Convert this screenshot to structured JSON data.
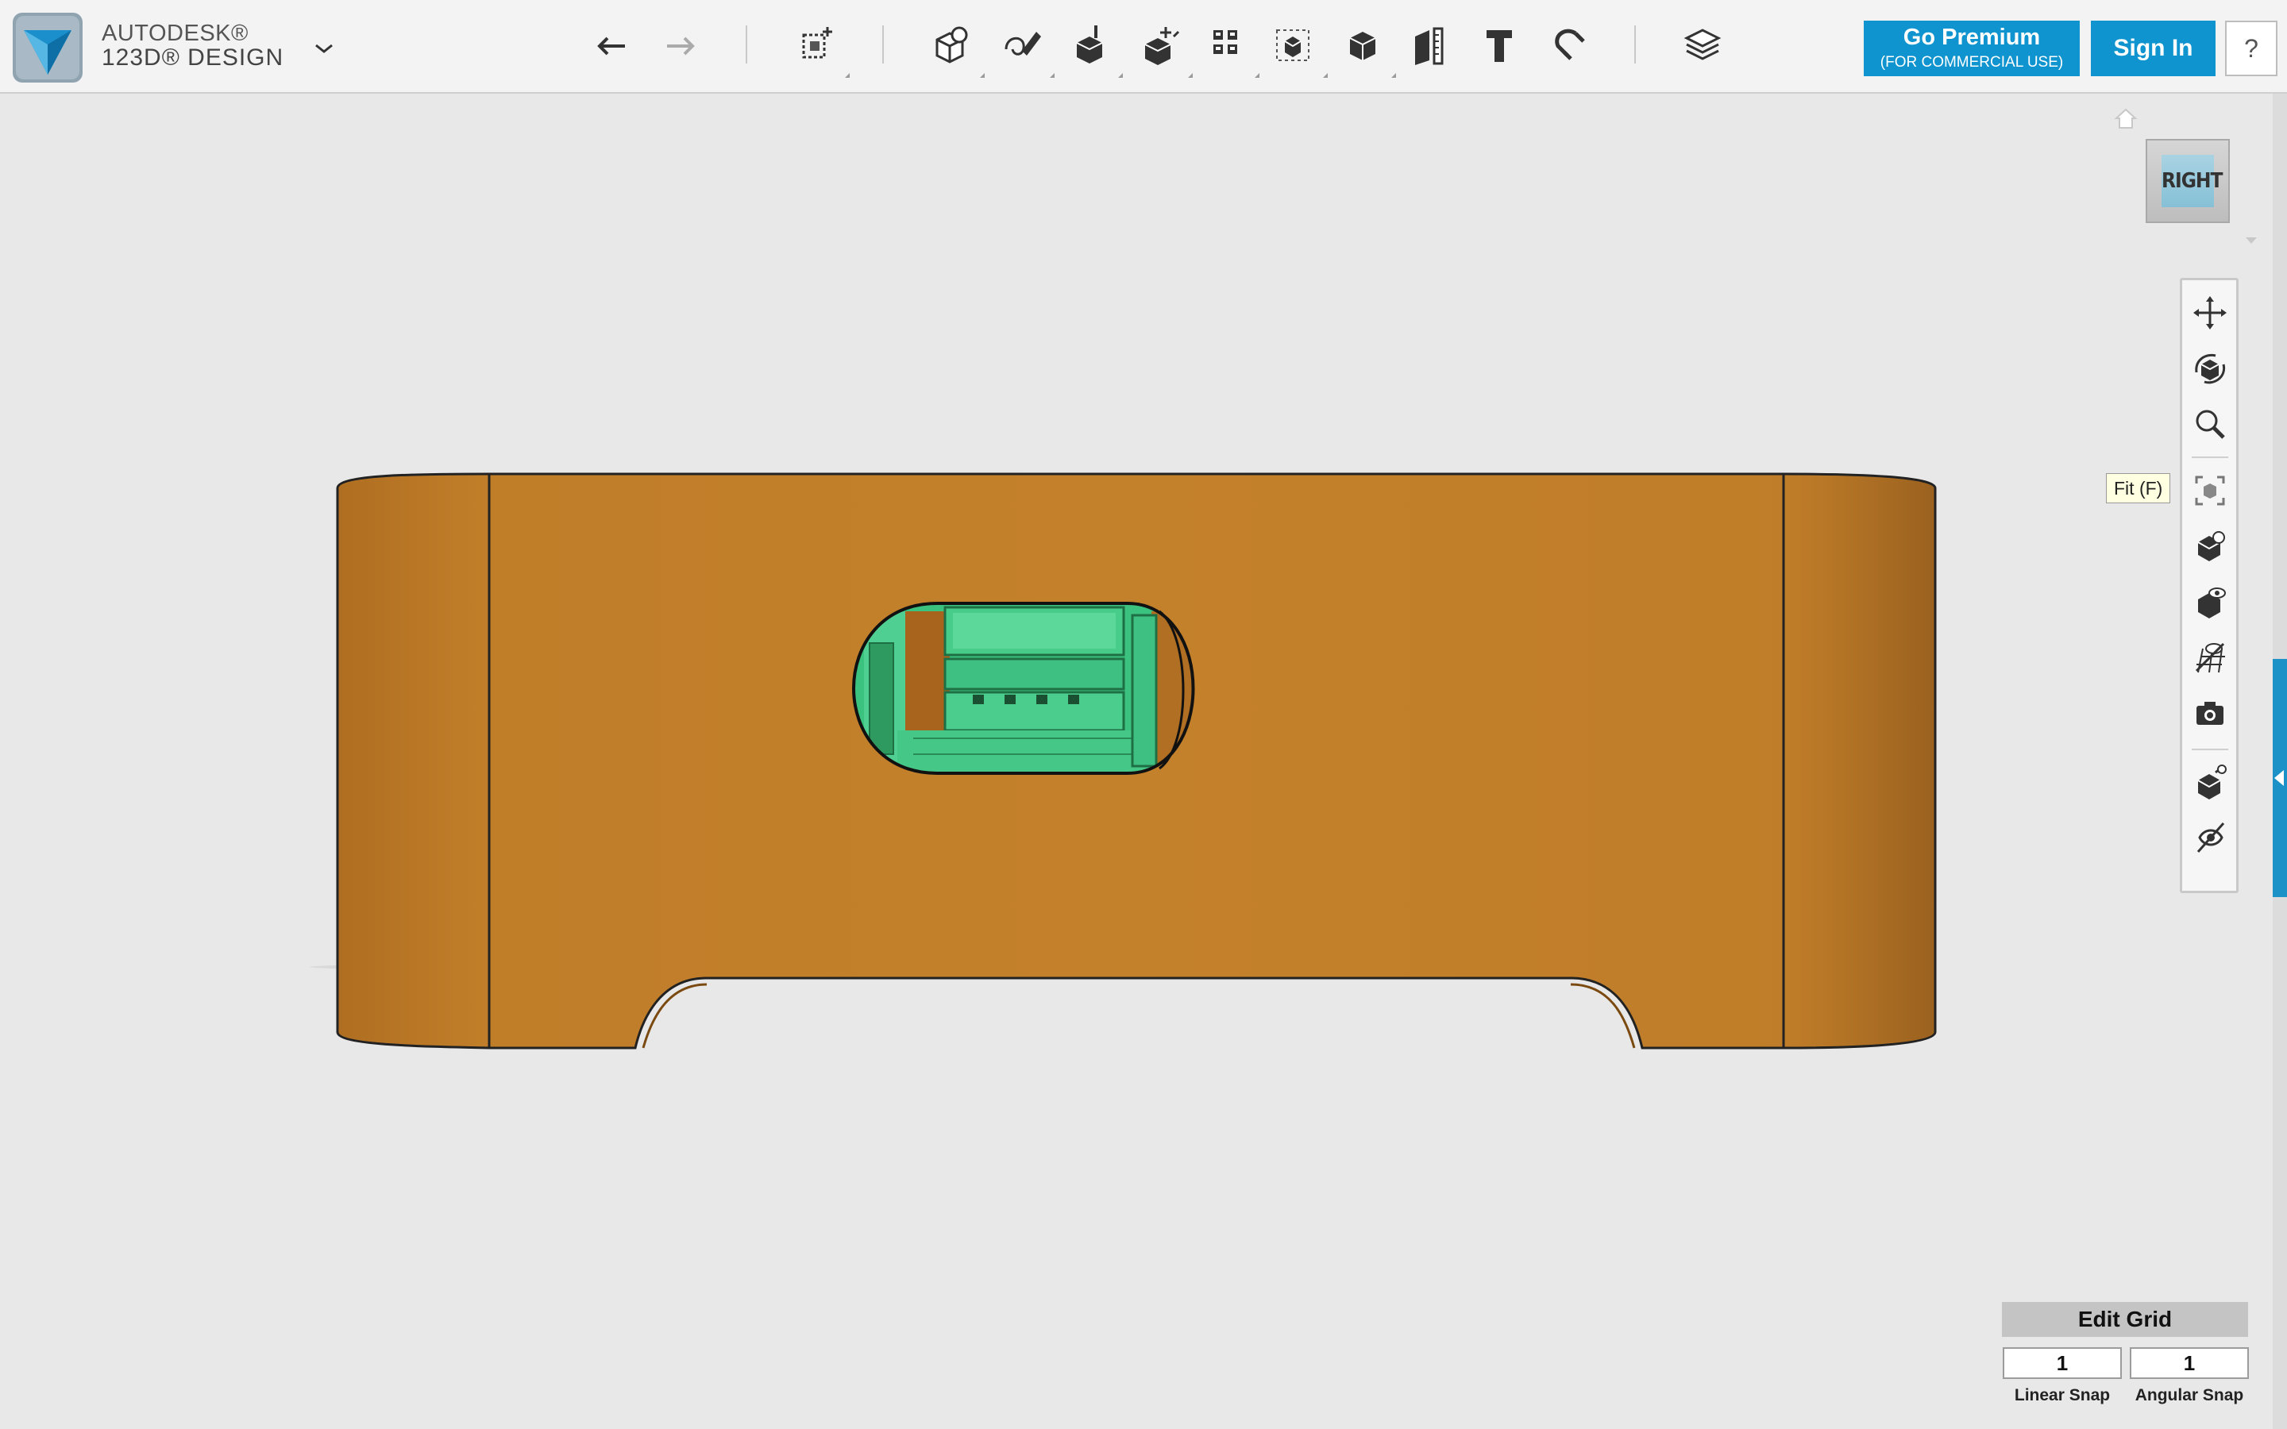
{
  "app": {
    "brand_line1": "AUTODESK®",
    "brand_line2": "123D® DESIGN"
  },
  "toolbar": {
    "tools": [
      {
        "name": "undo-icon"
      },
      {
        "name": "redo-icon"
      },
      {
        "name": "transform-icon"
      },
      {
        "name": "primitives-icon"
      },
      {
        "name": "sketch-icon"
      },
      {
        "name": "construct-icon"
      },
      {
        "name": "modify-icon"
      },
      {
        "name": "pattern-icon"
      },
      {
        "name": "group-icon"
      },
      {
        "name": "combine-icon"
      },
      {
        "name": "measure-icon"
      },
      {
        "name": "text-icon"
      },
      {
        "name": "snap-icon"
      },
      {
        "name": "material-icon"
      }
    ],
    "premium_label": "Go Premium",
    "premium_sublabel": "(FOR COMMERCIAL USE)",
    "signin_label": "Sign In",
    "help_label": "?"
  },
  "view_cube": {
    "face_label": "RIGHT"
  },
  "nav_bar": {
    "tools": [
      "pan-icon",
      "orbit-icon",
      "zoom-icon",
      "fit-icon",
      "view-icon",
      "visibility-icon",
      "grid-visibility-icon",
      "screenshot-icon",
      "material-view-icon",
      "hide-icon"
    ],
    "tooltip": "Fit (F)"
  },
  "grid": {
    "edit_label": "Edit Grid",
    "linear_snap_value": "1",
    "angular_snap_value": "1",
    "linear_snap_label": "Linear Snap",
    "angular_snap_label": "Angular Snap"
  },
  "colors": {
    "accent": "#0f94cf",
    "model_body": "#c17d28",
    "model_inner": "#3fc884"
  }
}
